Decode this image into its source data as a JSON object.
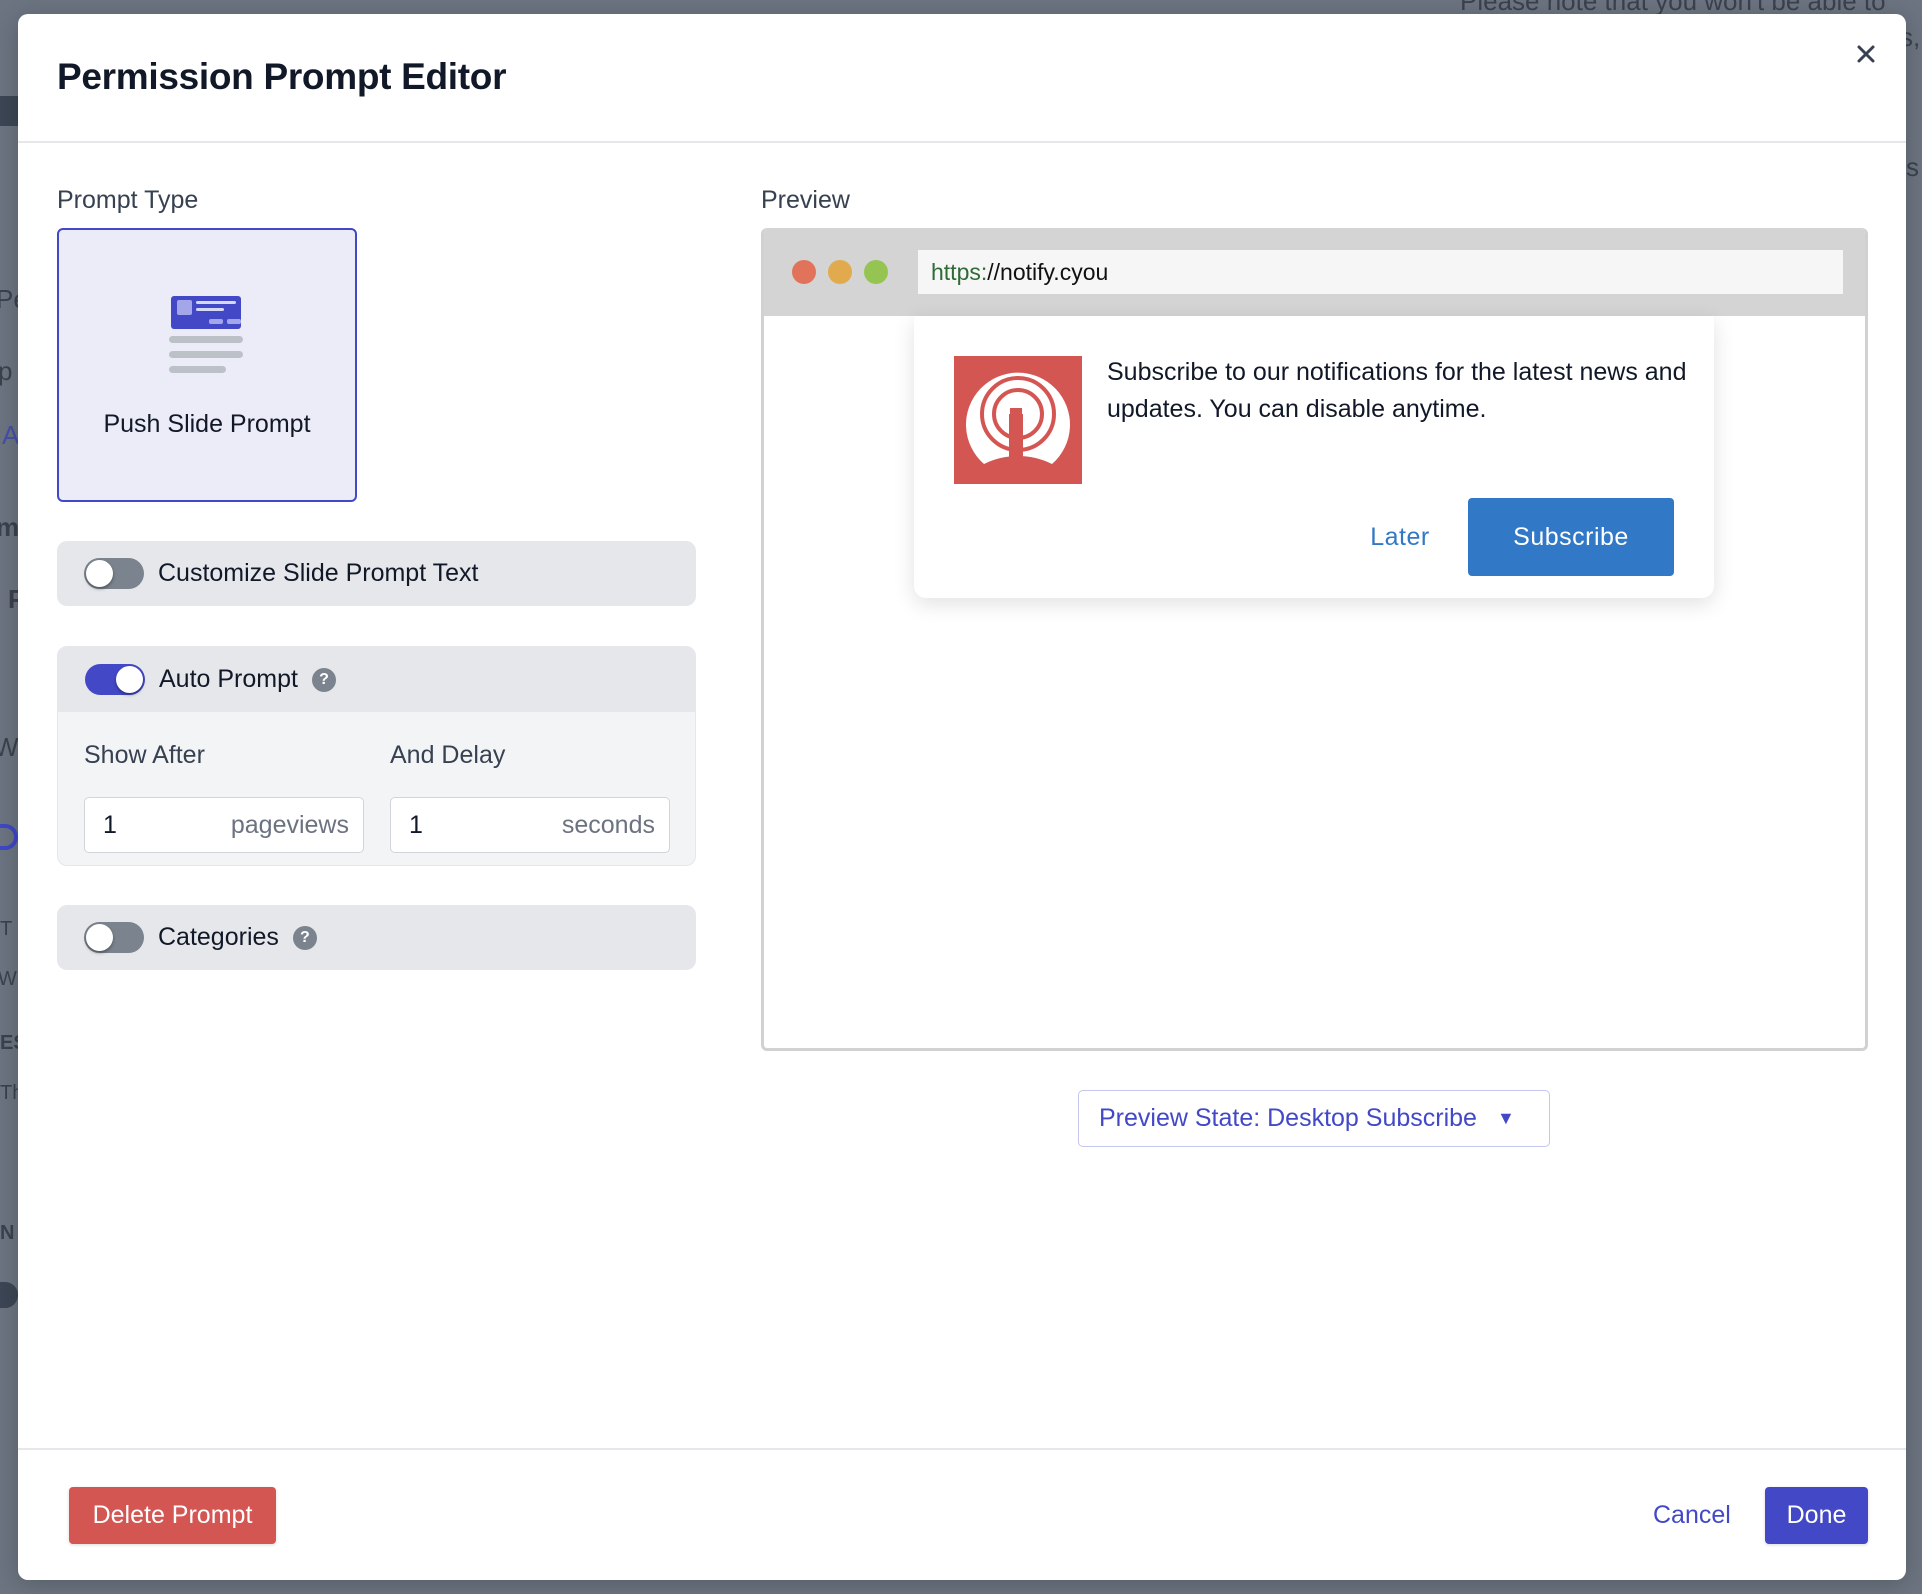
{
  "background": {
    "notice_fragment": "Please note that you won't be able to",
    "side_fragments": [
      "Pe",
      "p",
      "A",
      "m",
      "P",
      "W",
      "T",
      "W",
      "ES",
      "Th",
      "N"
    ],
    "right_fragments": [
      "s,",
      "s"
    ]
  },
  "modal": {
    "title": "Permission Prompt Editor",
    "close_icon": "close-icon"
  },
  "prompt_type": {
    "label": "Prompt Type",
    "selected": {
      "label": "Push Slide Prompt",
      "icon": "slide-prompt-icon"
    }
  },
  "options": {
    "customize_text": {
      "label": "Customize Slide Prompt Text",
      "enabled": false
    },
    "auto_prompt": {
      "label": "Auto Prompt",
      "enabled": true,
      "help_icon": "?",
      "show_after": {
        "label": "Show After",
        "value": "1",
        "unit": "pageviews"
      },
      "and_delay": {
        "label": "And Delay",
        "value": "1",
        "unit": "seconds"
      }
    },
    "categories": {
      "label": "Categories",
      "enabled": false,
      "help_icon": "?"
    }
  },
  "preview": {
    "label": "Preview",
    "url_scheme": "https:",
    "url_rest": "//notify.cyou",
    "popup": {
      "message": "Subscribe to our notifications for the latest news and updates. You can disable anytime.",
      "later_label": "Later",
      "subscribe_label": "Subscribe"
    },
    "state_select": {
      "label": "Preview State: Desktop Subscribe",
      "caret": "▼"
    }
  },
  "footer": {
    "delete_label": "Delete Prompt",
    "cancel_label": "Cancel",
    "done_label": "Done"
  },
  "colors": {
    "primary": "#4349c6",
    "danger": "#d45653",
    "preview_button": "#3178c6",
    "traffic_red": "#e0735a",
    "traffic_yellow": "#e0aa4d",
    "traffic_green": "#96c452"
  }
}
